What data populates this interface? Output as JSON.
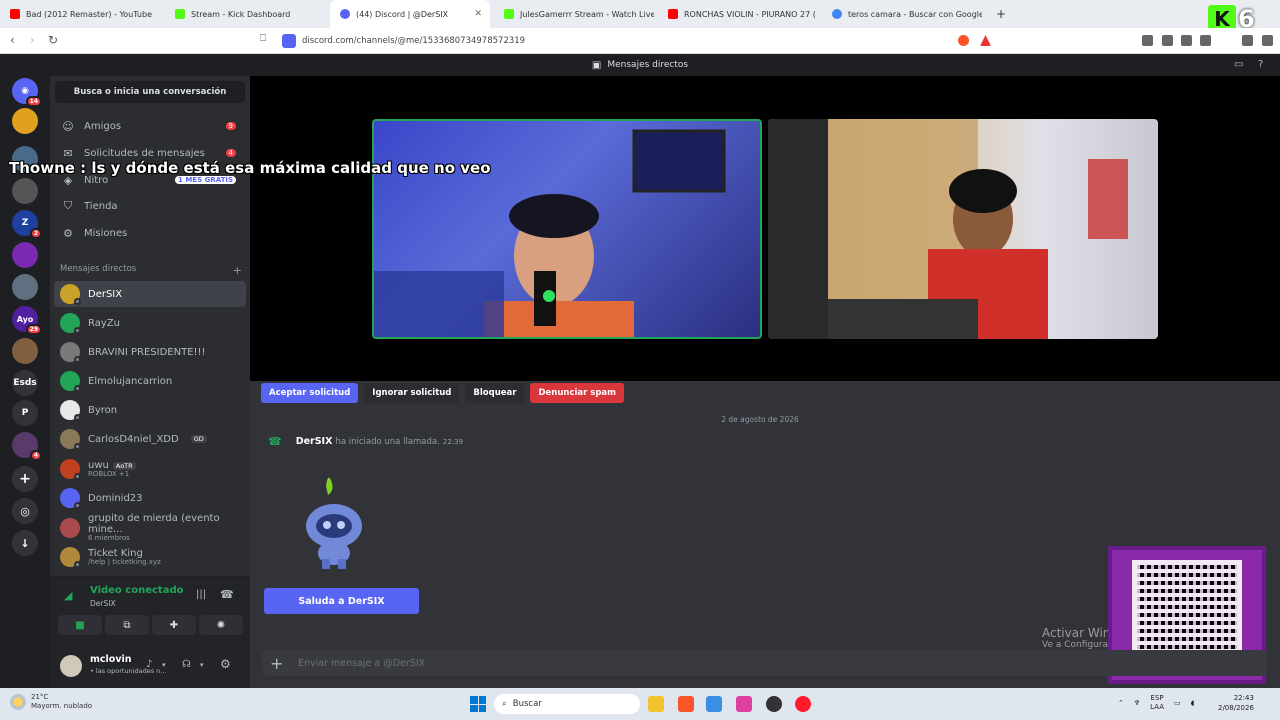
{
  "browser": {
    "tabs": [
      {
        "label": "Bad (2012 Remaster) - YouTube",
        "color": "#ff0000"
      },
      {
        "label": "Stream - Kick Dashboard",
        "color": "#53fc18"
      },
      {
        "label": "(44) Discord | @DerSIX",
        "color": "#5865f2"
      },
      {
        "label": "JulesGamerrr Stream - Watch Live on",
        "color": "#53fc18"
      },
      {
        "label": "RONCHAS VIOLIN - PIURANO 27 (",
        "color": "#ff0000"
      },
      {
        "label": "teros camara - Buscar con Google",
        "color": "#4285f4"
      }
    ],
    "new_tab": "+",
    "url": "discord.com/channels/@me/1533680734978572319"
  },
  "overlay_badge": {
    "letter": "K",
    "number": "6"
  },
  "discord": {
    "top_title": "Mensajes directos",
    "search_label": "Busca o inicia una conversación",
    "nav": [
      {
        "label": "Amigos",
        "icon": "friends-icon",
        "badge": "9"
      },
      {
        "label": "Solicitudes de mensajes",
        "icon": "mail-icon",
        "badge": "4"
      },
      {
        "label": "Nitro",
        "icon": "nitro-icon",
        "pill": "1 MES GRATIS"
      },
      {
        "label": "Tienda",
        "icon": "shop-icon"
      },
      {
        "label": "Misiones",
        "icon": "quest-icon"
      }
    ],
    "dm_header": "Mensajes directos",
    "dm_add": "+",
    "dms": [
      {
        "name": "DerSIX",
        "color": "#c9a227",
        "active": true
      },
      {
        "name": "RayZu",
        "color": "#23a559"
      },
      {
        "name": "BRAVINI PRESIDENTE!!!",
        "color": "#7a7a7a"
      },
      {
        "name": "Elmolujancarrion",
        "color": "#23a559"
      },
      {
        "name": "Byron",
        "color": "#e8e8e8"
      },
      {
        "name": "CarlosD4niel_XDD",
        "color": "#8a7a5a",
        "tag": "GD"
      },
      {
        "name": "uwu",
        "color": "#c04020",
        "tag": "AoTR",
        "sub": "ROBLOX +1"
      },
      {
        "name": "Dominid23",
        "color": "#5865f2"
      },
      {
        "name": "grupito de mierda (evento mine...",
        "color": "#aa4a4a",
        "sub": "6 miembros"
      },
      {
        "name": "Ticket King",
        "color": "#b08a3a",
        "sub": "/help | ticketking.xyz"
      }
    ],
    "servers": [
      {
        "label": "",
        "color": "#5865f2",
        "badge": "14"
      },
      {
        "label": "",
        "color": "#e0a020"
      },
      {
        "label": "",
        "color": "#4a6a8a"
      },
      {
        "label": "",
        "color": "#555555"
      },
      {
        "label": "Z",
        "color": "#2040a0",
        "badge": "2"
      },
      {
        "label": "",
        "color": "#7a2ab0"
      },
      {
        "label": "",
        "color": "#607080"
      },
      {
        "label": "Ayo",
        "color": "#5020a0",
        "badge": "29"
      },
      {
        "label": "",
        "color": "#806040"
      },
      {
        "label": "Esds",
        "color": "#313338"
      },
      {
        "label": "P",
        "color": "#313338"
      },
      {
        "label": "",
        "color": "#5a3a6a",
        "badge": "4"
      }
    ],
    "voice": {
      "status": "Video conectado",
      "channel": "DerSIX"
    },
    "user": {
      "name": "mclovin",
      "status": "• las oportunidades n..."
    },
    "actions": {
      "accept": "Aceptar solicitud",
      "ignore": "Ignorar solicitud",
      "block": "Bloquear",
      "report": "Denunciar spam"
    },
    "date_separator": "2 de agosto de 2026",
    "call_message": {
      "author": "DerSIX",
      "text": "ha iniciado una llamada.",
      "time": "22:39"
    },
    "wave_button": "Saluda a DerSIX",
    "input_placeholder": "Enviar mensaje a @DerSIX"
  },
  "overlay_chat": "Thowne : ls y dónde está esa máxima calidad que no veo",
  "windows_watermark": {
    "title": "Activar Win",
    "sub": "Ve a Configura"
  },
  "taskbar": {
    "weather_temp": "21°C",
    "weather_desc": "Mayorm. nublado",
    "search": "Buscar",
    "lang": "ESP",
    "region": "LAA",
    "time": "22:43",
    "date": "2/08/2026"
  },
  "colors": {
    "accent": "#5865f2",
    "online": "#23a559",
    "danger": "#da373c"
  }
}
